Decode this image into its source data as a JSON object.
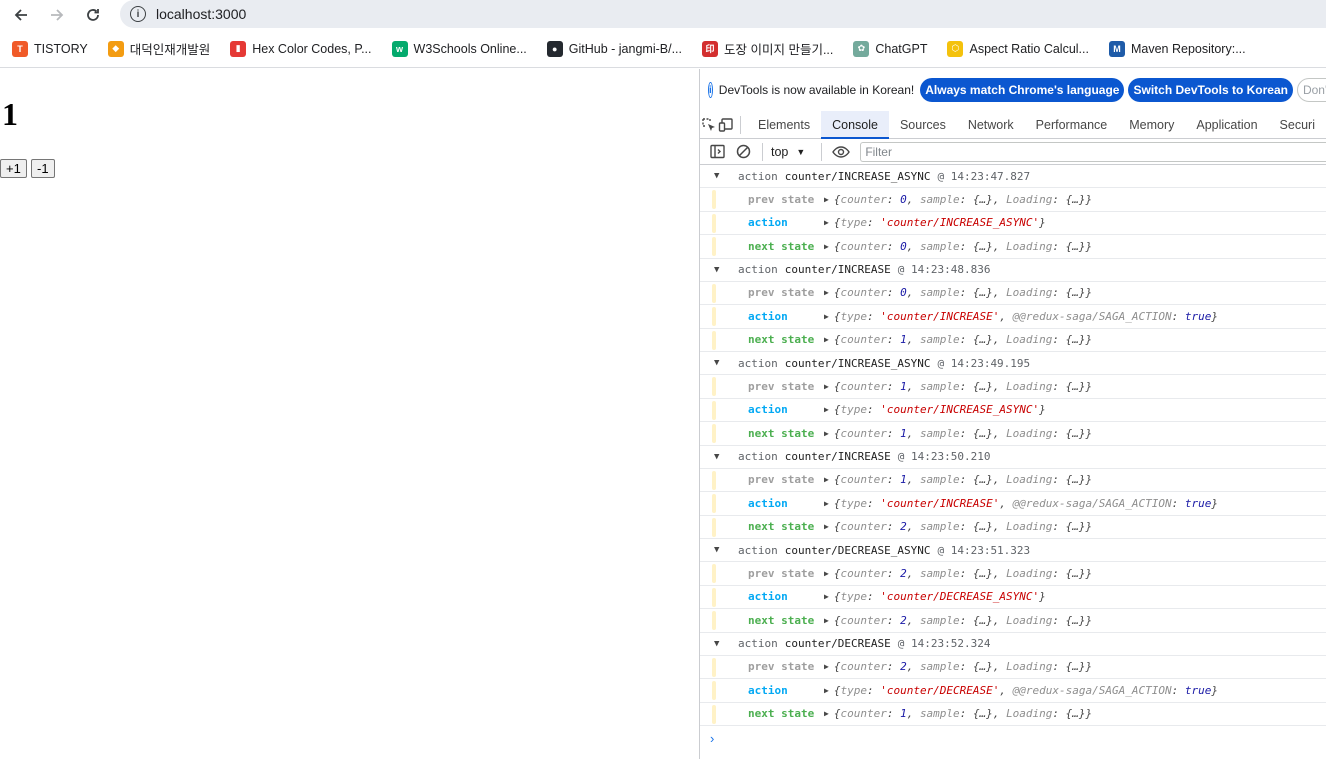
{
  "browser": {
    "url": "localhost:3000",
    "bookmarks": [
      {
        "label": "TISTORY",
        "icon": "tistory-icon",
        "color": "#f05a28",
        "glyph": "T"
      },
      {
        "label": "대덕인재개발원",
        "icon": "ddit-icon",
        "color": "#f39c12",
        "glyph": "◆"
      },
      {
        "label": "Hex Color Codes, P...",
        "icon": "hex-color-icon",
        "color": "#e53935",
        "glyph": "▮"
      },
      {
        "label": "W3Schools Online...",
        "icon": "w3schools-icon",
        "color": "#04aa6d",
        "glyph": "w"
      },
      {
        "label": "GitHub - jangmi-B/...",
        "icon": "github-icon",
        "color": "#24292f",
        "glyph": "●"
      },
      {
        "label": "도장 이미지 만들기...",
        "icon": "stamp-icon",
        "color": "#d32f2f",
        "glyph": "印"
      },
      {
        "label": "ChatGPT",
        "icon": "chatgpt-icon",
        "color": "#74aa9c",
        "glyph": "✿"
      },
      {
        "label": "Aspect Ratio Calcul...",
        "icon": "aspect-ratio-icon",
        "color": "#f4c20d",
        "glyph": "⬡"
      },
      {
        "label": "Maven Repository:...",
        "icon": "maven-icon",
        "color": "#1e5ba8",
        "glyph": "M"
      }
    ]
  },
  "page": {
    "counter": "1",
    "inc_label": "+1",
    "dec_label": "-1"
  },
  "devtools": {
    "info_message": "DevTools is now available in Korean!",
    "btn_match": "Always match Chrome's language",
    "btn_switch": "Switch DevTools to Korean",
    "btn_dont": "Don't sh",
    "tabs": [
      "Elements",
      "Console",
      "Sources",
      "Network",
      "Performance",
      "Memory",
      "Application",
      "Securi"
    ],
    "active_tab": "Console",
    "context": "top",
    "filter_placeholder": "Filter",
    "prompt": "›",
    "labels": {
      "head": "action",
      "at": "@",
      "prev": "prev state",
      "action": "action",
      "next": "next state"
    },
    "logs": [
      {
        "type": "counter/INCREASE_ASYNC",
        "time": "14:23:47.827",
        "prev_counter": "0",
        "action_type": "'counter/INCREASE_ASYNC'",
        "saga": false,
        "next_counter": "0"
      },
      {
        "type": "counter/INCREASE",
        "time": "14:23:48.836",
        "prev_counter": "0",
        "action_type": "'counter/INCREASE'",
        "saga": true,
        "next_counter": "1"
      },
      {
        "type": "counter/INCREASE_ASYNC",
        "time": "14:23:49.195",
        "prev_counter": "1",
        "action_type": "'counter/INCREASE_ASYNC'",
        "saga": false,
        "next_counter": "1"
      },
      {
        "type": "counter/INCREASE",
        "time": "14:23:50.210",
        "prev_counter": "1",
        "action_type": "'counter/INCREASE'",
        "saga": true,
        "next_counter": "2"
      },
      {
        "type": "counter/DECREASE_ASYNC",
        "time": "14:23:51.323",
        "prev_counter": "2",
        "action_type": "'counter/DECREASE_ASYNC'",
        "saga": false,
        "next_counter": "2"
      },
      {
        "type": "counter/DECREASE",
        "time": "14:23:52.324",
        "prev_counter": "2",
        "action_type": "'counter/DECREASE'",
        "saga": true,
        "next_counter": "1"
      }
    ],
    "state_text": {
      "counter_key": "counter",
      "sample": "sample",
      "loading": "Loading",
      "ellipsis": "{…}",
      "type_key": "type",
      "saga_key": "@@redux-saga/SAGA_ACTION",
      "saga_val": "true"
    }
  }
}
